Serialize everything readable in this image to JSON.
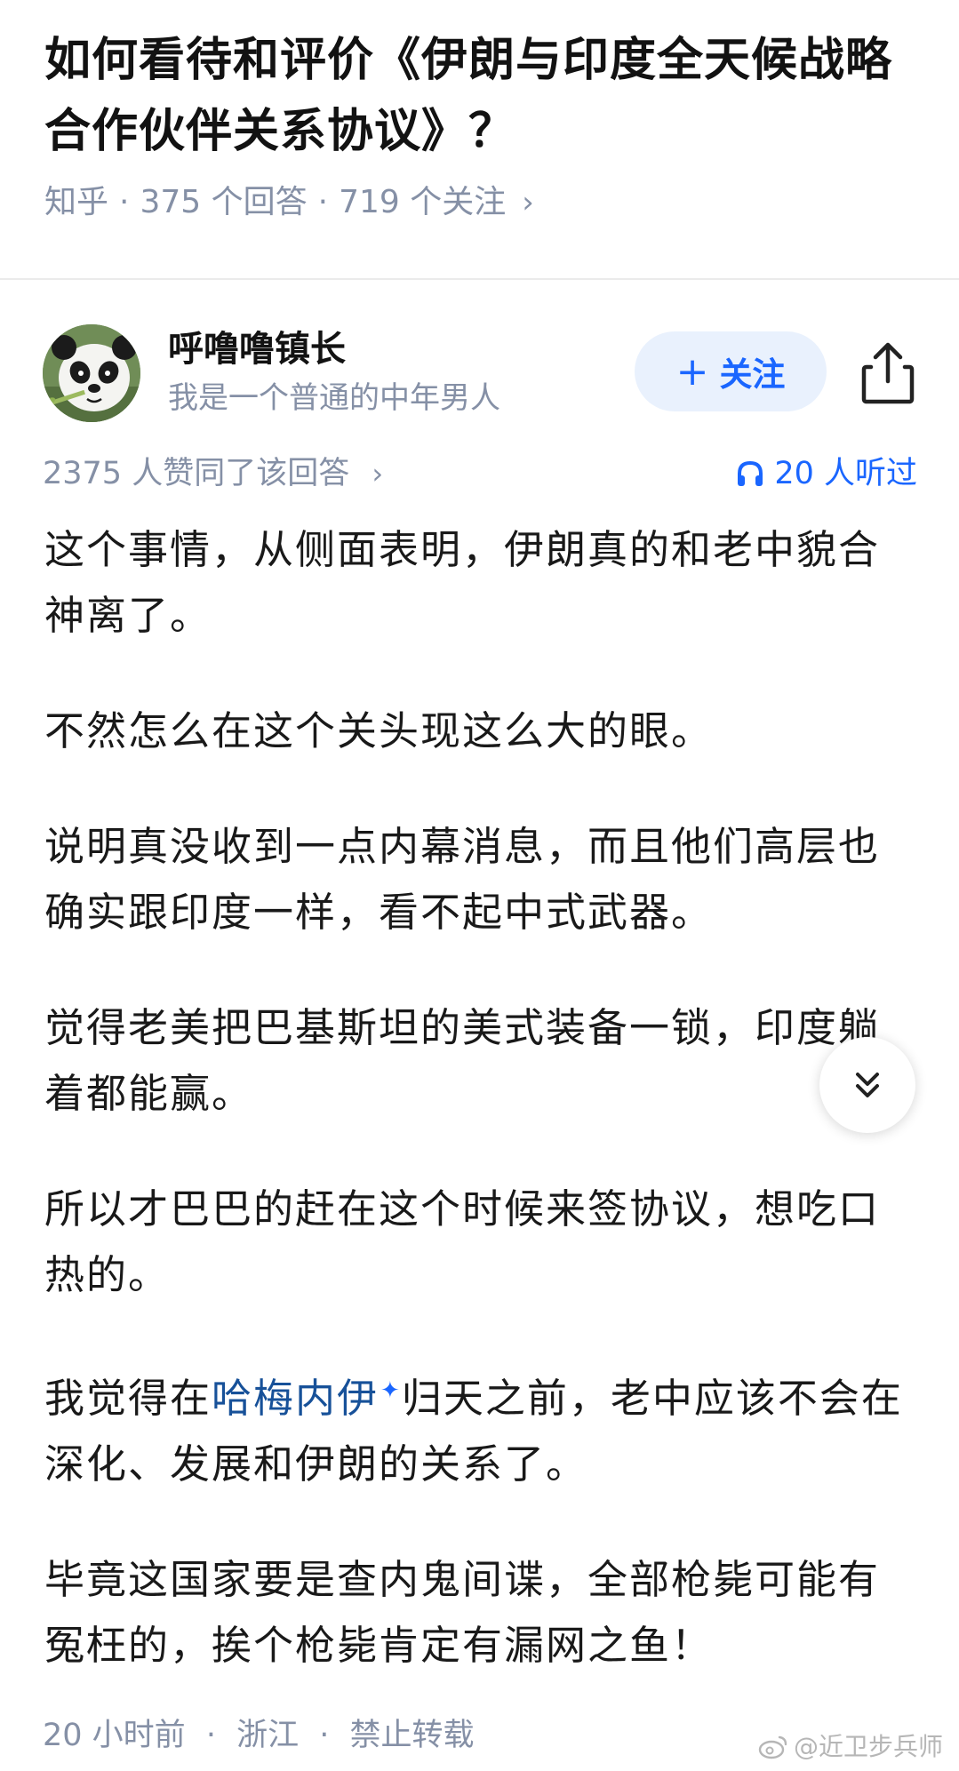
{
  "question": {
    "title": "如何看待和评价《伊朗与印度全天候战略合作伙伴关系协议》？",
    "source": "知乎",
    "answers_count": "375 个回答",
    "followers_count": "719 个关注",
    "meta_separator": "·",
    "chevron": "›"
  },
  "author": {
    "name": "呼噜噜镇长",
    "bio": "我是一个普通的中年男人",
    "avatar_icon": "panda-avatar"
  },
  "actions": {
    "follow_plus": "+",
    "follow_label": "关注",
    "share_icon": "share-icon"
  },
  "stats": {
    "upvote_text": "2375 人赞同了该回答",
    "chevron": "›",
    "listen_text": "20 人听过",
    "listen_icon": "headphones-icon"
  },
  "answer": {
    "paragraphs": [
      "这个事情，从侧面表明，伊朗真的和老中貌合神离了。",
      "不然怎么在这个关头现这么大的眼。",
      "说明真没收到一点内幕消息，而且他们高层也确实跟印度一样，看不起中式武器。",
      "觉得老美把巴基斯坦的美式装备一锁，印度躺着都能赢。",
      "所以才巴巴的赶在这个时候来签协议，想吃口热的。",
      {
        "before": "我觉得在",
        "link": "哈梅内伊",
        "link_mark": "✦",
        "after": "归天之前，老中应该不会在深化、发展和伊朗的关系了。"
      },
      "毕竟这国家要是查内鬼间谍，全部枪毙可能有冤枉的，挨个枪毙肯定有漏网之鱼！"
    ]
  },
  "footer": {
    "time": "20 小时前",
    "location": "浙江",
    "copyright": "禁止转载",
    "separator": "·"
  },
  "watermark": {
    "text": "@近卫步兵师",
    "icon": "weibo-icon"
  },
  "colors": {
    "accent": "#1a66ff",
    "link": "#175199",
    "meta_gray": "#8590a6",
    "follow_bg": "#e9f1fd",
    "text": "#191919"
  }
}
